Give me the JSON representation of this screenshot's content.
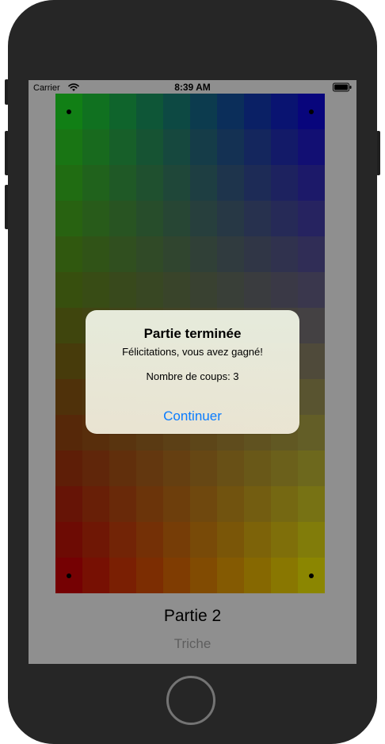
{
  "status_bar": {
    "carrier": "Carrier",
    "time": "8:39 AM",
    "wifi_icon": "wifi-icon",
    "battery_icon": "battery-icon"
  },
  "board": {
    "columns": 10,
    "rows": 14,
    "top_left_color": "#117f15",
    "top_right_color": "#08057c",
    "bottom_left_color": "#750103",
    "bottom_right_color": "#8b8601",
    "marked_cells": [
      {
        "row": 0,
        "col": 0
      },
      {
        "row": 0,
        "col": 9
      },
      {
        "row": 13,
        "col": 0
      },
      {
        "row": 13,
        "col": 9
      }
    ]
  },
  "dialog": {
    "title": "Partie terminée",
    "message": "Félicitations, vous avez gagné!",
    "moves": "Nombre de coups: 3",
    "button_label": "Continuer",
    "accent_color": "#0a7cff"
  },
  "game": {
    "title": "Partie 2",
    "cheat_label": "Triche"
  },
  "device": {
    "home_button_icon": "home-button-icon"
  }
}
